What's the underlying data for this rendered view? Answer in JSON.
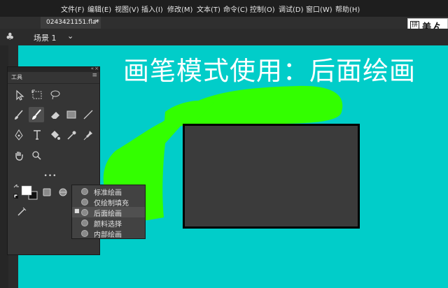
{
  "menu": {
    "items": [
      {
        "label": "文件(F)"
      },
      {
        "label": "编辑(E)"
      },
      {
        "label": "视图(V)"
      },
      {
        "label": "插入(I)"
      },
      {
        "label": "修改(M)"
      },
      {
        "label": "文本(T)"
      },
      {
        "label": "命令(C)"
      },
      {
        "label": "控制(O)"
      },
      {
        "label": "调试(D)"
      },
      {
        "label": "窗口(W)"
      },
      {
        "label": "帮助(H)"
      }
    ]
  },
  "document_tab": {
    "title": "0243421151.fla*",
    "close": "×"
  },
  "ime": {
    "pin": "拼",
    "text": "美ゟ"
  },
  "scene": {
    "icon": "club-icon",
    "label": "场景 1",
    "chevron": "⌄"
  },
  "stage": {
    "title": "画笔模式使用：后面绘画",
    "background_color": "#01cdc9",
    "brush_stroke_color": "#33ff00",
    "rectangle_fill": "#3b3b3b"
  },
  "tools_panel": {
    "title": "工具",
    "collapse": "«",
    "close": "×",
    "menu": "≡",
    "more": "•••",
    "stroke_color": "#000000",
    "fill_color": "#ffffff"
  },
  "brush_mode_menu": {
    "items": [
      {
        "label": "标准绘画",
        "selected": false
      },
      {
        "label": "仅绘制填充",
        "selected": false
      },
      {
        "label": "后面绘画",
        "selected": true,
        "mark": "■"
      },
      {
        "label": "颜料选择",
        "selected": false
      },
      {
        "label": "内部绘画",
        "selected": false
      }
    ]
  }
}
